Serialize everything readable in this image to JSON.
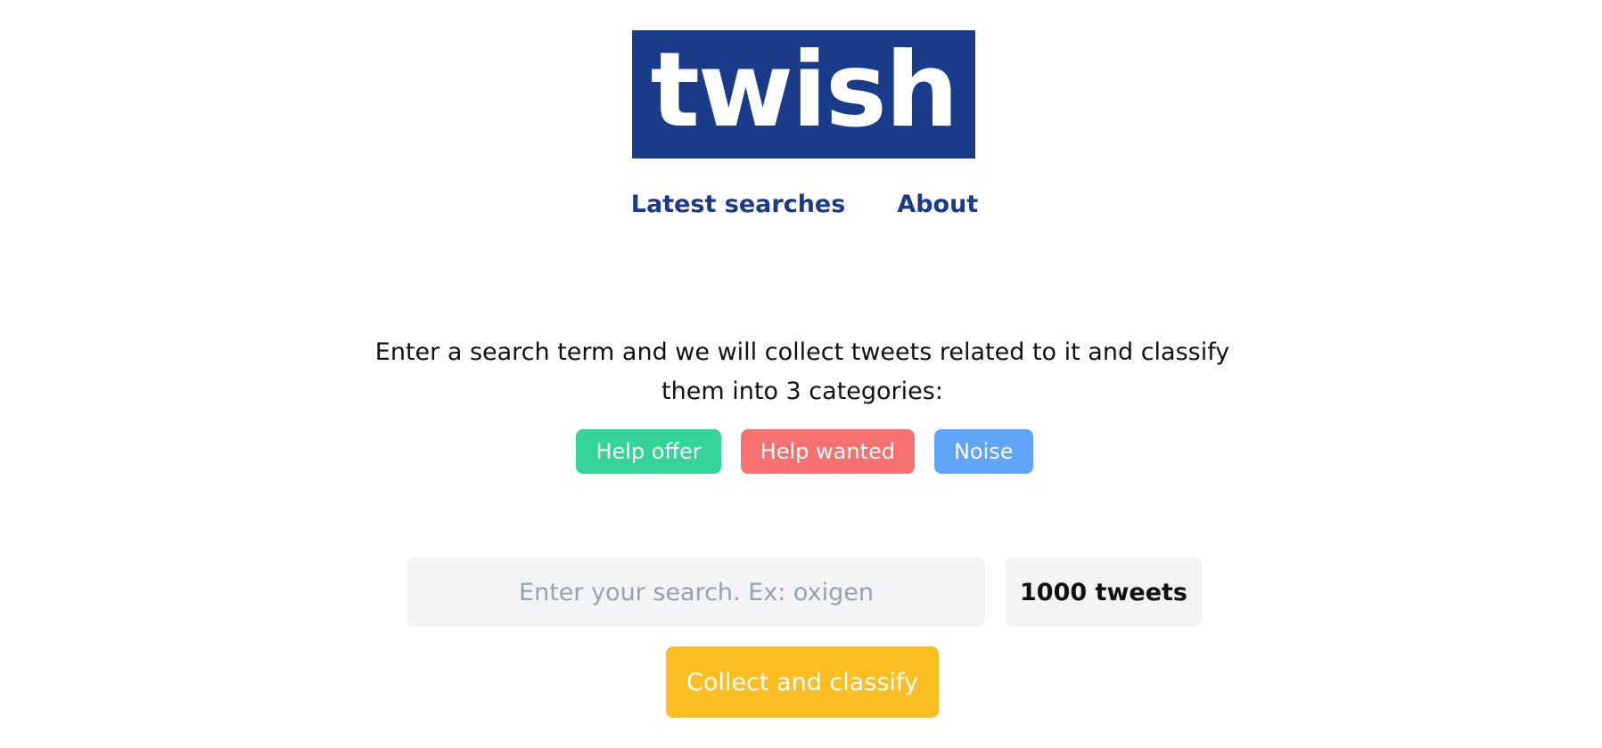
{
  "logo": {
    "text": "twish"
  },
  "nav": {
    "latest_searches": "Latest searches",
    "about": "About"
  },
  "intro": {
    "text": "Enter a search term and we will collect tweets related to it and classify them into 3 categories:"
  },
  "categories": [
    {
      "label": "Help offer",
      "color": "#34d399"
    },
    {
      "label": "Help wanted",
      "color": "#f87171"
    },
    {
      "label": "Noise",
      "color": "#60a5fa"
    }
  ],
  "search": {
    "placeholder": "Enter your search. Ex: oxigen",
    "value": ""
  },
  "tweet_count": {
    "selected": "1000 tweets"
  },
  "submit": {
    "label": "Collect and classify"
  },
  "colors": {
    "brand": "#1a3a8a",
    "submit": "#fbbf24",
    "input_bg": "#f3f4f6"
  }
}
